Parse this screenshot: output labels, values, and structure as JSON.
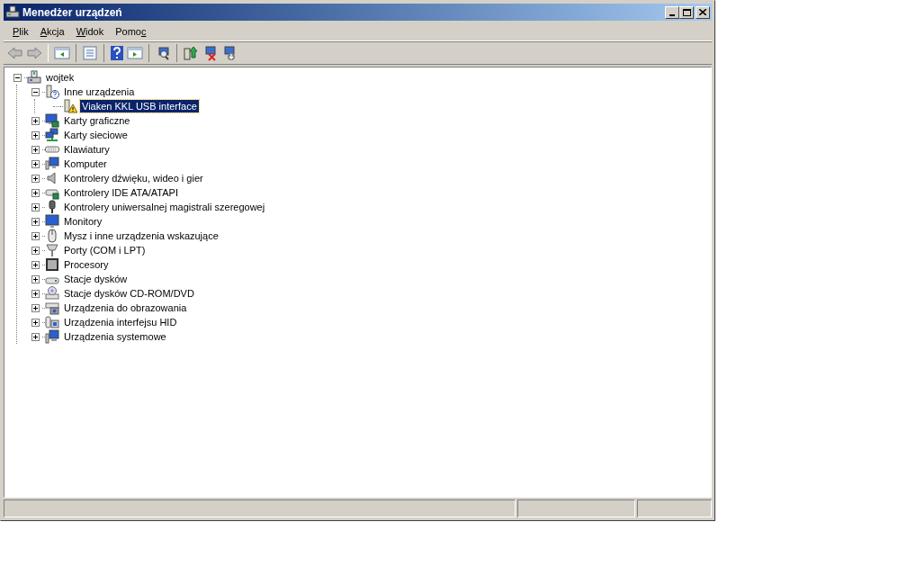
{
  "window": {
    "title": "Menedżer urządzeń"
  },
  "menu": [
    {
      "access_key": "P",
      "after": "lik"
    },
    {
      "access_key": "A",
      "after": "kcja"
    },
    {
      "access_key": "W",
      "after": "idok"
    },
    {
      "before": "Pomo",
      "access_key": "c"
    }
  ],
  "tree": [
    {
      "label": "wojtek",
      "expanded": true,
      "selected": false,
      "children": [
        {
          "label": "Inne urządzenia",
          "expanded": true,
          "selected": false,
          "children": [
            {
              "label": "Viaken KKL USB interface",
              "selected": true
            }
          ]
        },
        {
          "label": "Karty graficzne",
          "expanded": false,
          "selected": false
        },
        {
          "label": "Karty sieciowe",
          "expanded": false,
          "selected": false
        },
        {
          "label": "Klawiatury",
          "expanded": false,
          "selected": false
        },
        {
          "label": "Komputer",
          "expanded": false,
          "selected": false
        },
        {
          "label": "Kontrolery dźwięku, wideo i gier",
          "expanded": false,
          "selected": false
        },
        {
          "label": "Kontrolery IDE ATA/ATAPI",
          "expanded": false,
          "selected": false
        },
        {
          "label": "Kontrolery uniwersalnej magistrali szeregowej",
          "expanded": false,
          "selected": false
        },
        {
          "label": "Monitory",
          "expanded": false,
          "selected": false
        },
        {
          "label": "Mysz i inne urządzenia wskazujące",
          "expanded": false,
          "selected": false
        },
        {
          "label": "Porty (COM i LPT)",
          "expanded": false,
          "selected": false
        },
        {
          "label": "Procesory",
          "expanded": false,
          "selected": false
        },
        {
          "label": "Stacje dysków",
          "expanded": false,
          "selected": false
        },
        {
          "label": "Stacje dysków CD-ROM/DVD",
          "expanded": false,
          "selected": false
        },
        {
          "label": "Urządzenia do obrazowania",
          "expanded": false,
          "selected": false
        },
        {
          "label": "Urządzenia interfejsu HID",
          "expanded": false,
          "selected": false
        },
        {
          "label": "Urządzenia systemowe",
          "expanded": false,
          "selected": false
        }
      ]
    }
  ]
}
